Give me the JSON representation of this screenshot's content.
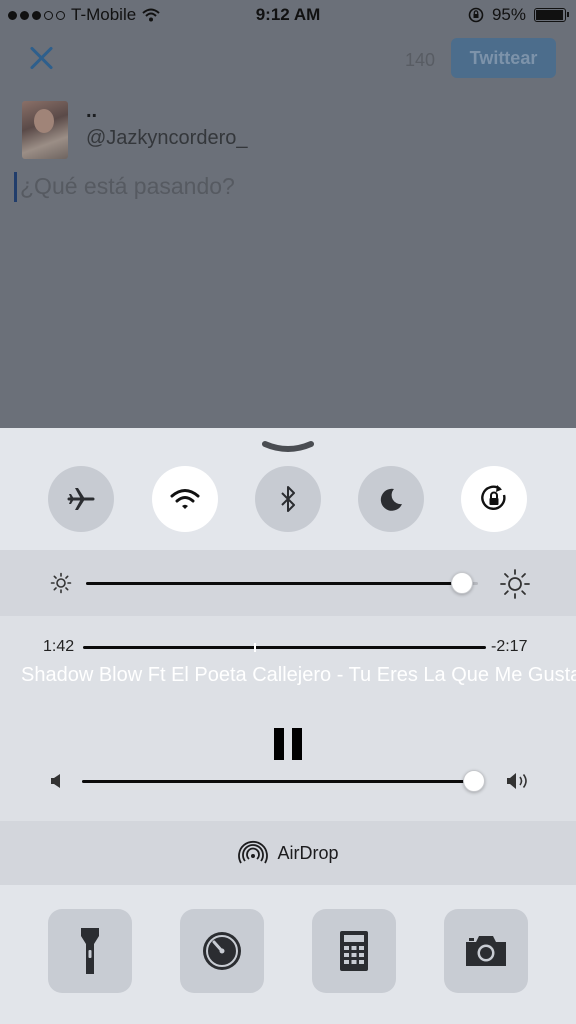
{
  "status_bar": {
    "carrier": "T-Mobile",
    "signal_bars_filled": 3,
    "signal_bars_total": 5,
    "time": "9:12 AM",
    "battery_percent": "95%",
    "battery_level": 0.95
  },
  "composer": {
    "char_count": "140",
    "tweet_button": "Twittear",
    "user_name": "..",
    "handle": "@Jazkyncordero_",
    "placeholder": "¿Qué está pasando?"
  },
  "control_center": {
    "toggles": [
      {
        "name": "airplane-mode",
        "icon": "airplane-icon",
        "on": false
      },
      {
        "name": "wifi",
        "icon": "wifi-icon",
        "on": true
      },
      {
        "name": "bluetooth",
        "icon": "bluetooth-icon",
        "on": false
      },
      {
        "name": "do-not-disturb",
        "icon": "moon-icon",
        "on": false
      },
      {
        "name": "rotation-lock",
        "icon": "rotation-lock-icon",
        "on": true
      }
    ],
    "brightness_level": 0.96,
    "music": {
      "elapsed": "1:42",
      "remaining": "-2:17",
      "progress": 0.425,
      "title": "Shadow Blow Ft El Poeta Callejero - Tu Eres La Que Me Gusta"
    },
    "volume_level": 0.98,
    "airdrop_label": "AirDrop",
    "tools": [
      "flashlight-icon",
      "timer-icon",
      "calculator-icon",
      "camera-icon"
    ]
  }
}
